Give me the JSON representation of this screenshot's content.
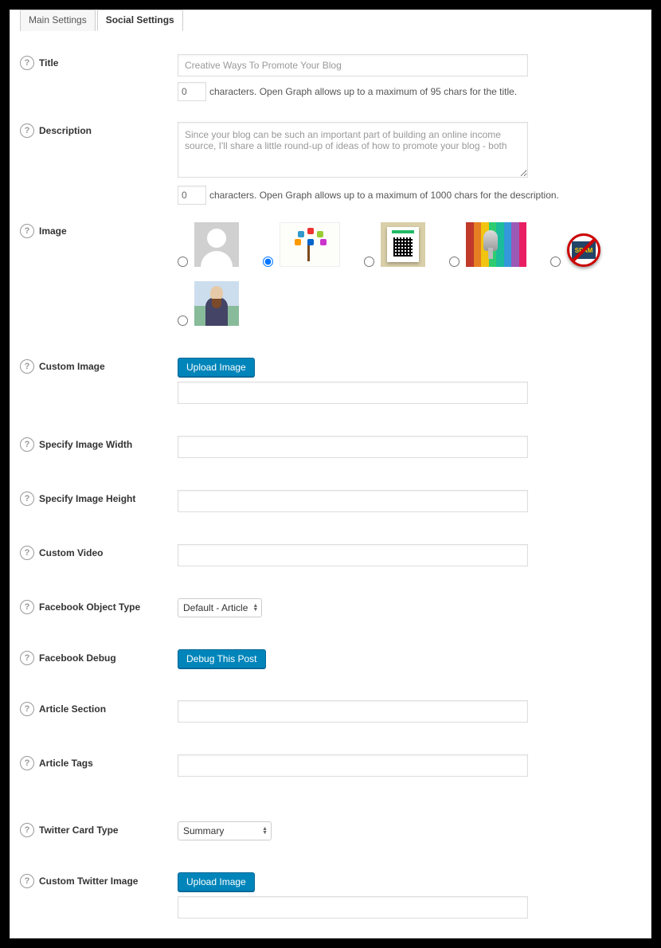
{
  "tabs": {
    "main": "Main Settings",
    "social": "Social Settings"
  },
  "fields": {
    "title": {
      "label": "Title",
      "value": "Creative Ways To Promote Your Blog",
      "count": "0",
      "hint": "characters. Open Graph allows up to a maximum of 95 chars for the title."
    },
    "description": {
      "label": "Description",
      "value": "Since your blog can be such an important part of building an online income source, I'll share a little round-up of ideas of how to promote your blog - both",
      "count": "0",
      "hint": "characters. Open Graph allows up to a maximum of 1000 chars for the description."
    },
    "image": {
      "label": "Image"
    },
    "custom_image": {
      "label": "Custom Image",
      "button": "Upload Image"
    },
    "image_width": {
      "label": "Specify Image Width"
    },
    "image_height": {
      "label": "Specify Image Height"
    },
    "custom_video": {
      "label": "Custom Video"
    },
    "fb_object_type": {
      "label": "Facebook Object Type",
      "selected": "Default - Article"
    },
    "fb_debug": {
      "label": "Facebook Debug",
      "button": "Debug This Post"
    },
    "article_section": {
      "label": "Article Section"
    },
    "article_tags": {
      "label": "Article Tags"
    },
    "twitter_card": {
      "label": "Twitter Card Type",
      "selected": "Summary"
    },
    "custom_twitter_image": {
      "label": "Custom Twitter Image",
      "button": "Upload Image"
    }
  },
  "spam_text": "SPAM"
}
